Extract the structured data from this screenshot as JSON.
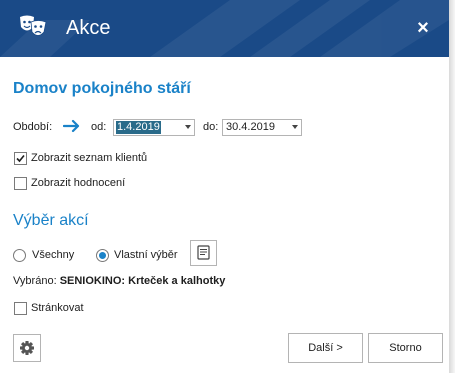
{
  "window": {
    "title": "Akce",
    "close_glyph": "×",
    "icon": "theater-masks-icon"
  },
  "heading": "Domov pokojného stáří",
  "period": {
    "label": "Období:",
    "from_label": "od:",
    "from_value": "1.4.2019",
    "to_label": "do:",
    "to_value": "30.4.2019"
  },
  "options": {
    "show_clients_label": "Zobrazit seznam klientů",
    "show_clients_checked": true,
    "show_rating_label": "Zobrazit hodnocení",
    "show_rating_checked": false
  },
  "selection": {
    "title": "Výběr akcí",
    "all_label": "Všechny",
    "custom_label": "Vlastní výběr",
    "selected_option": "custom",
    "selected_prefix": "Vybráno:",
    "selected_value": "SENIOKINO: Krteček a kalhotky"
  },
  "paging": {
    "label": "Stránkovat",
    "checked": false
  },
  "footer": {
    "next_label": "Další >",
    "cancel_label": "Storno"
  },
  "colors": {
    "titlebar": "#1a4a87",
    "accent": "#1a82c8"
  }
}
